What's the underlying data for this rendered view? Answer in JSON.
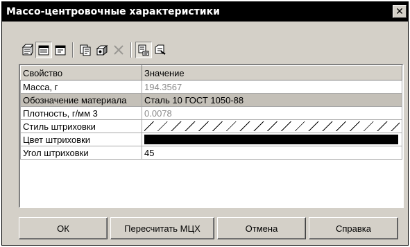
{
  "window": {
    "title": "Масcо-центровочные характеристики"
  },
  "toolbar": {
    "icons": [
      {
        "name": "calc-props-icon",
        "pressed": false,
        "disabled": false
      },
      {
        "name": "doc-view-icon",
        "pressed": true,
        "disabled": false
      },
      {
        "name": "doc-edit-icon",
        "pressed": false,
        "disabled": false
      },
      {
        "name": "parts-icon",
        "pressed": false,
        "disabled": false
      },
      {
        "name": "assembly-icon",
        "pressed": false,
        "disabled": false
      },
      {
        "name": "delete-icon",
        "pressed": false,
        "disabled": true
      },
      {
        "name": "copy-icon",
        "pressed": true,
        "disabled": false
      },
      {
        "name": "paste-icon",
        "pressed": false,
        "disabled": false
      }
    ]
  },
  "table": {
    "headers": [
      "Свойство",
      "Значение"
    ],
    "rows": [
      {
        "property": "Масса, г",
        "value": "194.3567",
        "readonly": true,
        "kind": "text"
      },
      {
        "property": "Обозначение материала",
        "value": "Сталь 10  ГОСТ 1050-88",
        "readonly": false,
        "kind": "text",
        "selected": true
      },
      {
        "property": "Плотность, г/мм 3",
        "value": "0.0078",
        "readonly": true,
        "kind": "text"
      },
      {
        "property": "Стиль штриховки",
        "value": "",
        "readonly": false,
        "kind": "hatch"
      },
      {
        "property": "Цвет штриховки",
        "value": "",
        "readonly": false,
        "kind": "color",
        "color": "#000000"
      },
      {
        "property": "Угол штриховки",
        "value": "45",
        "readonly": false,
        "kind": "text"
      }
    ]
  },
  "buttons": {
    "ok": "ОК",
    "recalc": "Пересчитать МЦХ",
    "cancel": "Отмена",
    "help": "Справка"
  }
}
